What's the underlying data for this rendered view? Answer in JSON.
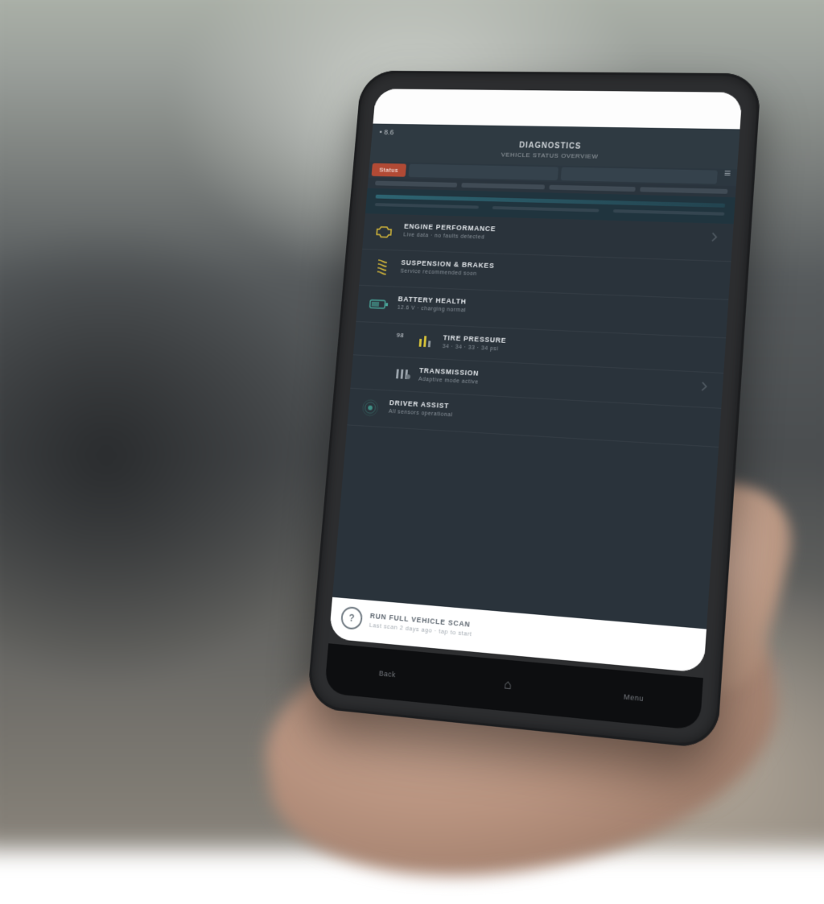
{
  "status": {
    "time": "",
    "carrier": ""
  },
  "header": {
    "crumb": "• 8.6",
    "title": "DIAGNOSTICS",
    "subtitle": "VEHICLE STATUS OVERVIEW"
  },
  "tabs": {
    "active_label": "Status",
    "menu_glyph": "≡"
  },
  "list": [
    {
      "icon": "engine-icon",
      "title": "ENGINE PERFORMANCE",
      "subtitle": "Live data · no faults detected"
    },
    {
      "icon": "spring-icon",
      "title": "SUSPENSION & BRAKES",
      "subtitle": "Service recommended soon"
    },
    {
      "icon": "battery-icon",
      "title": "BATTERY HEALTH",
      "subtitle": "12.6 V · charging normal"
    },
    {
      "icon": "bars-icon",
      "title": "TIRE PRESSURE",
      "subtitle": "34 · 34 · 33 · 34 psi",
      "sub": true,
      "badge": "98"
    },
    {
      "icon": "sliders-icon",
      "title": "TRANSMISSION",
      "subtitle": "Adaptive mode active",
      "sub": true
    },
    {
      "icon": "radar-icon",
      "title": "DRIVER ASSIST",
      "subtitle": "All sensors operational"
    }
  ],
  "footer": {
    "icon_glyph": "?",
    "line1": "RUN FULL VEHICLE SCAN",
    "line2": "Last scan 2 days ago · tap to start"
  },
  "nav": {
    "left": "Back",
    "home_glyph": "⌂",
    "right": "Menu"
  }
}
